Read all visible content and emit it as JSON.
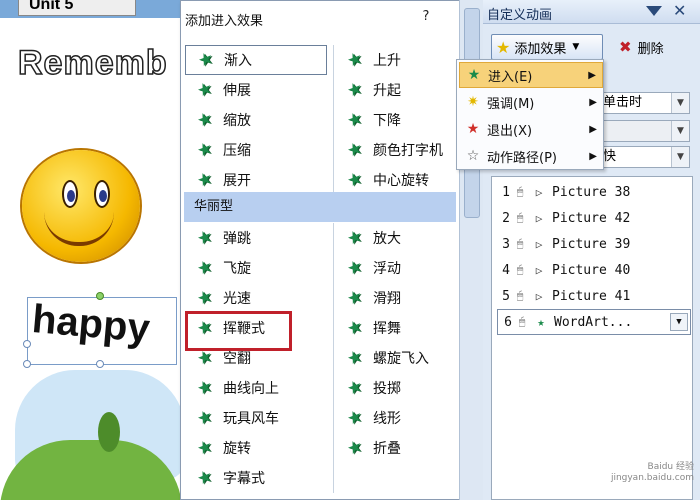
{
  "slide": {
    "banner_text": "Unit 5",
    "heading": "Rememb",
    "word": "happy"
  },
  "dialog": {
    "title": "添加进入效果",
    "help": "?",
    "basic_left": [
      "渐入",
      "伸展",
      "缩放",
      "压缩",
      "展开"
    ],
    "basic_right": [
      "上升",
      "升起",
      "下降",
      "颜色打字机",
      "中心旋转"
    ],
    "group_label": "华丽型",
    "fancy_left": [
      "弹跳",
      "飞旋",
      "光速",
      "挥鞭式",
      "空翻",
      "曲线向上",
      "玩具风车",
      "旋转",
      "字幕式"
    ],
    "fancy_right": [
      "放大",
      "浮动",
      "滑翔",
      "挥舞",
      "螺旋飞入",
      "投掷",
      "线形",
      "折叠"
    ]
  },
  "pane": {
    "title": "自定义动画",
    "add_effect": "添加效果",
    "delete": "删除",
    "start_value": "单击时",
    "speed_value": "快",
    "animations": [
      {
        "num": "1",
        "label": "Picture 38"
      },
      {
        "num": "2",
        "label": "Picture 42"
      },
      {
        "num": "3",
        "label": "Picture 39"
      },
      {
        "num": "4",
        "label": "Picture 40"
      },
      {
        "num": "5",
        "label": "Picture 41"
      },
      {
        "num": "6",
        "label": "WordArt..."
      }
    ]
  },
  "menu": {
    "items": [
      {
        "label": "进入(E)",
        "icon": "enter-star-icon"
      },
      {
        "label": "强调(M)",
        "icon": "emphasis-star-icon"
      },
      {
        "label": "退出(X)",
        "icon": "exit-star-icon"
      },
      {
        "label": "动作路径(P)",
        "icon": "motion-path-star-icon"
      }
    ]
  },
  "watermark": {
    "line1": "Baidu 经验",
    "line2": "jingyan.baidu.com"
  },
  "colors": {
    "highlight": "#c0202a",
    "group_header": "#b8cff0",
    "menu_active": "#f7d27a",
    "effect_star": "#1a8a4a"
  }
}
